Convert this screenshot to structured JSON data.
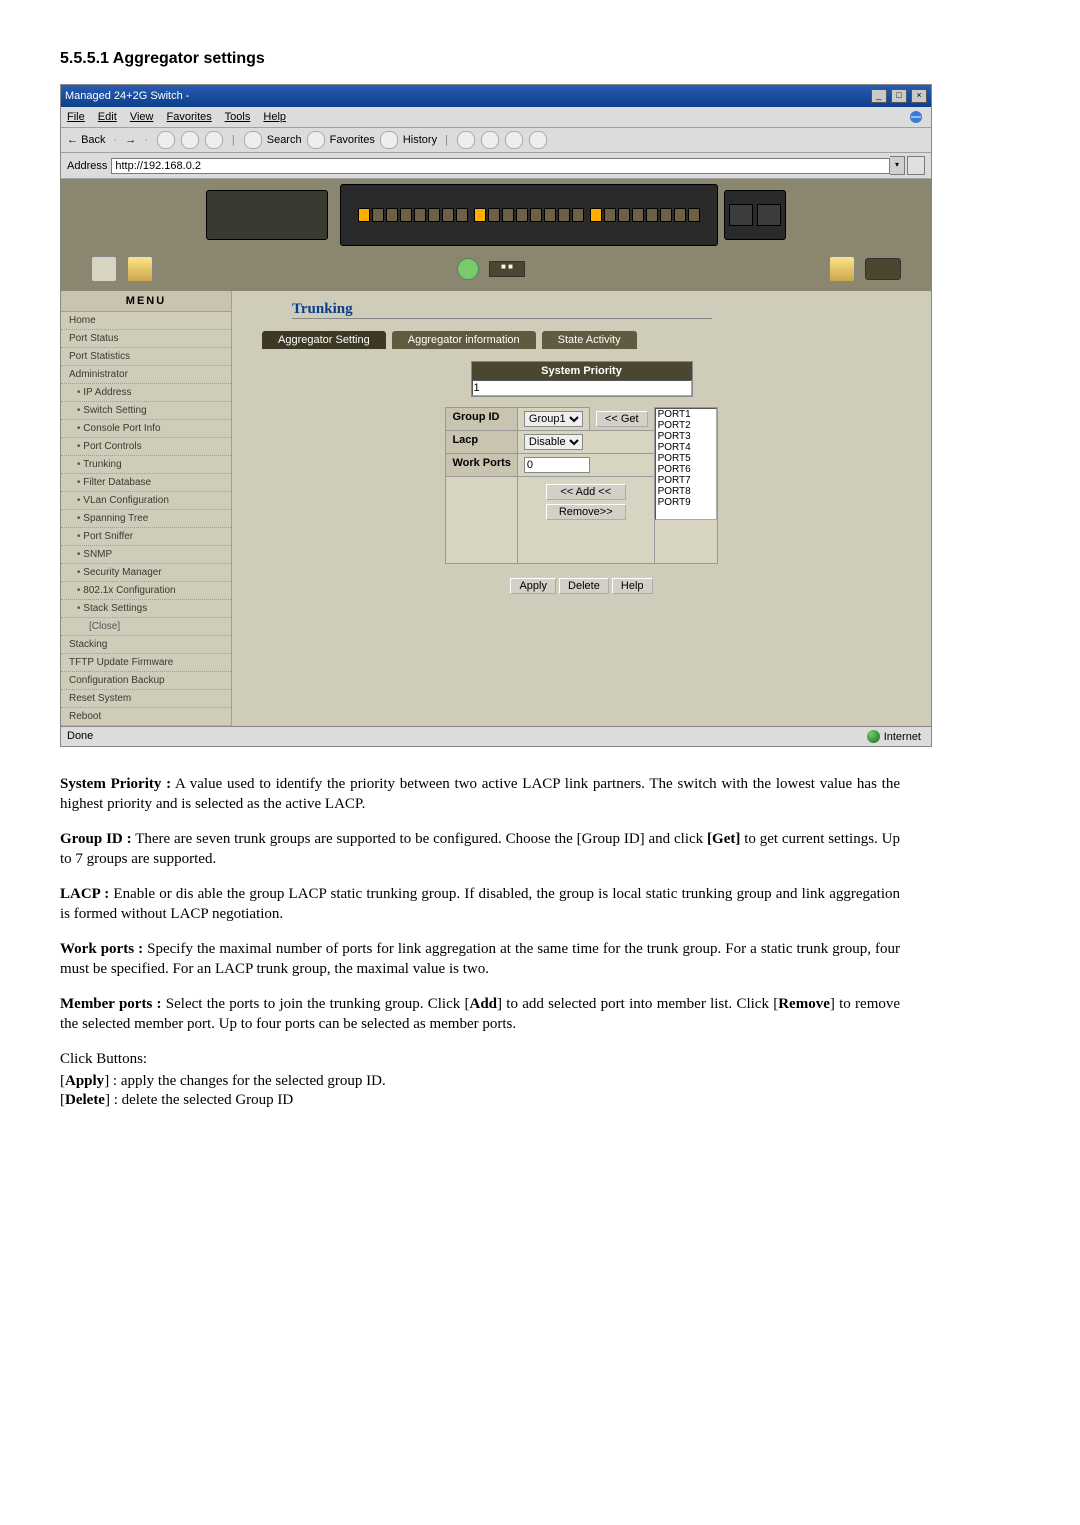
{
  "section_heading": "5.5.5.1 Aggregator settings",
  "browser": {
    "window_title": "Managed 24+2G Switch -",
    "menu": {
      "file": "File",
      "edit": "Edit",
      "view": "View",
      "favorites": "Favorites",
      "tools": "Tools",
      "help": "Help"
    },
    "toolbar": {
      "back": "Back",
      "search": "Search",
      "favorites": "Favorites",
      "history": "History"
    },
    "address_label": "Address",
    "address_value": "http://192.168.0.2",
    "status_done": "Done",
    "status_zone": "Internet"
  },
  "menu": {
    "head": "MENU",
    "items": [
      "Home",
      "Port Status",
      "Port Statistics",
      "Administrator",
      "IP Address",
      "Switch Setting",
      "Console Port Info",
      "Port Controls",
      "Trunking",
      "Filter Database",
      "VLan Configuration",
      "Spanning Tree",
      "Port Sniffer",
      "SNMP",
      "Security Manager",
      "802.1x Configuration",
      "Stack Settings",
      "[Close]",
      "Stacking",
      "TFTP Update Firmware",
      "Configuration Backup",
      "Reset System",
      "Reboot"
    ]
  },
  "page": {
    "title": "Trunking",
    "tabs": {
      "setting": "Aggregator Setting",
      "info": "Aggregator information",
      "activity": "State Activity"
    },
    "sys_prio_label": "System Priority",
    "sys_prio_value": "1",
    "row_group_id": "Group ID",
    "group_id_value": "Group1",
    "get_btn": "<< Get",
    "row_lacp": "Lacp",
    "lacp_value": "Disable",
    "row_workports": "Work Ports",
    "workports_value": "0",
    "add_btn": "<< Add <<",
    "remove_btn": "Remove>>",
    "ports": [
      "PORT1",
      "PORT2",
      "PORT3",
      "PORT4",
      "PORT5",
      "PORT6",
      "PORT7",
      "PORT8",
      "PORT9"
    ],
    "apply": "Apply",
    "delete": "Delete",
    "help": "Help"
  },
  "paras": {
    "sys_prio_term": "System Priority :",
    "sys_prio_text": " A value used to identify the priority between two active LACP link partners. The switch with the lowest value has the highest priority and is selected as the active LACP.",
    "group_id_term": "Group ID :",
    "group_id_text1": " There are seven trunk groups are supported to be configured. Choose the [Group ID] and click ",
    "group_id_get": "[Get]",
    "group_id_text2": " to get current settings. Up to 7 groups are supported.",
    "lacp_term": "LACP :",
    "lacp_text": " Enable or dis able the group LACP static trunking group. If disabled, the group is local static trunking group and link aggregation is formed without LACP negotiation.",
    "workports_term": "Work ports :",
    "workports_text": " Specify the maximal number of ports for link aggregation at the same time for the trunk group. For a static trunk group, four must be specified. For an LACP trunk group, the maximal value is two.",
    "member_term": "Member ports :",
    "member_text1": " Select the ports to join the trunking group. Click [",
    "member_add": "Add",
    "member_text2": "] to add selected port into member list. Click [",
    "member_remove": "Remove",
    "member_text3": "] to remove the selected member port. Up to four ports can be selected as member ports.",
    "click_buttons": "Click Buttons:",
    "apply_line1": "[",
    "apply_bold": "Apply",
    "apply_line2": "] : apply the changes for the selected group ID.",
    "delete_line1": "[",
    "delete_bold": "Delete",
    "delete_line2": "] : delete the selected Group ID"
  }
}
